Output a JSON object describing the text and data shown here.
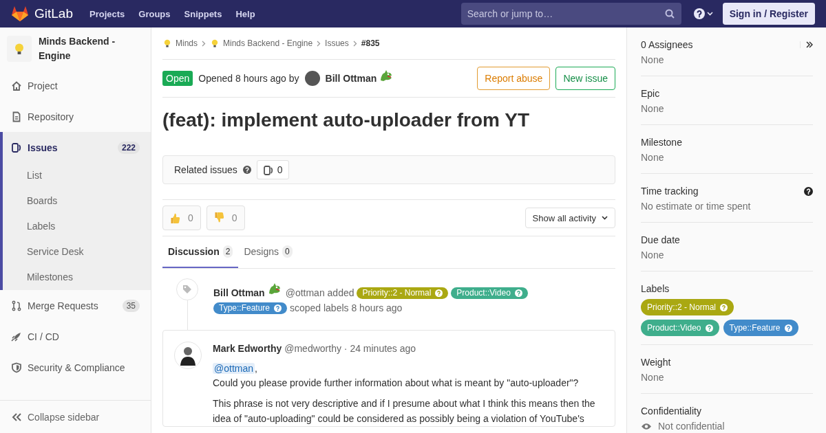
{
  "topbar": {
    "brand": "GitLab",
    "nav": [
      "Projects",
      "Groups",
      "Snippets",
      "Help"
    ],
    "search": {
      "placeholder": "Search or jump to…"
    },
    "signin": "Sign in / Register"
  },
  "project": {
    "name": "Minds Backend - Engine"
  },
  "sidebar": {
    "items": [
      {
        "kind": "home",
        "label": "Project",
        "selected": false
      },
      {
        "kind": "doc",
        "label": "Repository",
        "selected": false
      },
      {
        "kind": "issues",
        "label": "Issues",
        "count": "222",
        "selected": true,
        "children": [
          {
            "label": "List"
          },
          {
            "label": "Boards"
          },
          {
            "label": "Labels"
          },
          {
            "label": "Service Desk"
          },
          {
            "label": "Milestones"
          }
        ]
      },
      {
        "kind": "merge",
        "label": "Merge Requests",
        "count": "35",
        "selected": false
      },
      {
        "kind": "rocket",
        "label": "CI / CD",
        "selected": false
      },
      {
        "kind": "shield",
        "label": "Security & Compliance",
        "selected": false
      }
    ],
    "collapse": "Collapse sidebar"
  },
  "breadcrumbs": [
    {
      "label": "Minds",
      "avatar": true,
      "current": false
    },
    {
      "label": "Minds Backend - Engine",
      "avatar": true,
      "current": false
    },
    {
      "label": "Issues",
      "avatar": false,
      "current": false
    },
    {
      "label": "#835",
      "avatar": false,
      "current": true
    }
  ],
  "issue": {
    "status": "Open",
    "meta": "Opened 8 hours ago by",
    "author": "Bill Ottman",
    "buttons": [
      {
        "label": "Report abuse",
        "kind": "warning"
      },
      {
        "label": "New issue",
        "kind": "success"
      }
    ],
    "title": "(feat): implement auto-uploader from YT"
  },
  "related": {
    "label": "Related issues",
    "count": "0"
  },
  "awards": [
    {
      "kind": "up",
      "count": "0"
    },
    {
      "kind": "down",
      "count": "0"
    }
  ],
  "activity_filter": "Show all activity",
  "tabs": [
    {
      "label": "Discussion",
      "count": "2",
      "selected": true
    },
    {
      "label": "Designs",
      "count": "0",
      "selected": false
    }
  ],
  "system_note": {
    "author": "Bill Ottman",
    "action": "@ottman added",
    "labels": [
      {
        "text": "Priority::2 - Normal",
        "color": "#aaa812"
      },
      {
        "text": "Product::Video",
        "color": "#3fae8c"
      },
      {
        "text": "Type::Feature",
        "color": "#428bca"
      }
    ],
    "suffix": "scoped labels 8 hours ago"
  },
  "comment": {
    "author": "Mark Edworthy",
    "handle": "@medworthy",
    "time": "· 24 minutes ago",
    "mention": "@ottman",
    "mention_after": ",",
    "lines": [
      "Could you please provide further information about what is meant by \"auto-uploader\"?"
    ],
    "paragraph": "This phrase is not very descriptive and if I presume about what I think this means then the idea of \"auto-uploading\" could be considered as possibly being a violation of YouTube's"
  },
  "right_sidebar": [
    {
      "kind": "text",
      "title": "0 Assignees",
      "value": "None"
    },
    {
      "kind": "text",
      "title": "Epic",
      "value": "None"
    },
    {
      "kind": "text",
      "title": "Milestone",
      "value": "None"
    },
    {
      "kind": "help",
      "title": "Time tracking",
      "value": "No estimate or time spent"
    },
    {
      "kind": "text",
      "title": "Due date",
      "value": "None"
    },
    {
      "kind": "labels",
      "title": "Labels",
      "labels": [
        {
          "text": "Priority::2 - Normal",
          "color": "#aaa812"
        },
        {
          "text": "Product::Video",
          "color": "#3fae8c"
        },
        {
          "text": "Type::Feature",
          "color": "#428bca"
        }
      ]
    },
    {
      "kind": "text",
      "title": "Weight",
      "value": "None"
    },
    {
      "kind": "eye",
      "title": "Confidentiality",
      "value": "Not confidential"
    }
  ]
}
